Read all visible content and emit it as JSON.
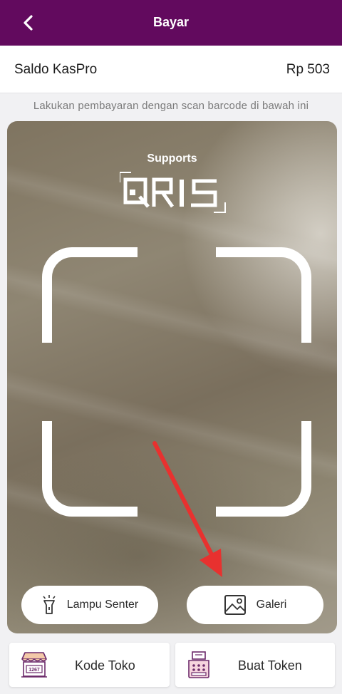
{
  "header": {
    "title": "Bayar",
    "back_icon": "chevron-left-icon"
  },
  "saldo": {
    "label": "Saldo KasPro",
    "value": "Rp 503"
  },
  "instruction": "Lakukan pembayaran dengan scan barcode di bawah ini",
  "scanner": {
    "supports_label": "Supports",
    "logo_text": "QRIS",
    "frame": "scan-frame-corners",
    "annotation": "red-arrow-pointing-galeri"
  },
  "actions": {
    "lampu_label": "Lampu Senter",
    "lampu_icon": "flashlight-icon",
    "galeri_label": "Galeri",
    "galeri_icon": "image-gallery-icon"
  },
  "bottom": {
    "kode_label": "Kode Toko",
    "kode_icon": "store-icon",
    "kode_icon_number": "1267",
    "token_label": "Buat Token",
    "token_icon": "cash-register-icon"
  },
  "colors": {
    "header_bg": "#620a5e",
    "accent": "#6c2a6a",
    "arrow": "#e8312f"
  }
}
